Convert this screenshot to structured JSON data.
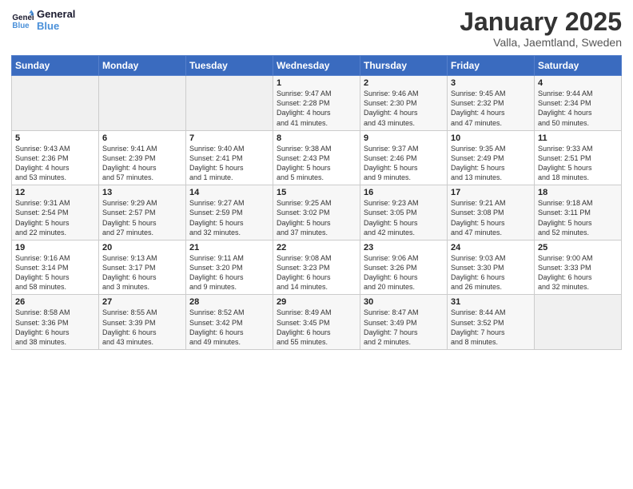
{
  "header": {
    "title": "January 2025",
    "subtitle": "Valla, Jaemtland, Sweden"
  },
  "days": [
    "Sunday",
    "Monday",
    "Tuesday",
    "Wednesday",
    "Thursday",
    "Friday",
    "Saturday"
  ],
  "weeks": [
    [
      {
        "day": "",
        "content": ""
      },
      {
        "day": "",
        "content": ""
      },
      {
        "day": "",
        "content": ""
      },
      {
        "day": "1",
        "content": "Sunrise: 9:47 AM\nSunset: 2:28 PM\nDaylight: 4 hours\nand 41 minutes."
      },
      {
        "day": "2",
        "content": "Sunrise: 9:46 AM\nSunset: 2:30 PM\nDaylight: 4 hours\nand 43 minutes."
      },
      {
        "day": "3",
        "content": "Sunrise: 9:45 AM\nSunset: 2:32 PM\nDaylight: 4 hours\nand 47 minutes."
      },
      {
        "day": "4",
        "content": "Sunrise: 9:44 AM\nSunset: 2:34 PM\nDaylight: 4 hours\nand 50 minutes."
      }
    ],
    [
      {
        "day": "5",
        "content": "Sunrise: 9:43 AM\nSunset: 2:36 PM\nDaylight: 4 hours\nand 53 minutes."
      },
      {
        "day": "6",
        "content": "Sunrise: 9:41 AM\nSunset: 2:39 PM\nDaylight: 4 hours\nand 57 minutes."
      },
      {
        "day": "7",
        "content": "Sunrise: 9:40 AM\nSunset: 2:41 PM\nDaylight: 5 hours\nand 1 minute."
      },
      {
        "day": "8",
        "content": "Sunrise: 9:38 AM\nSunset: 2:43 PM\nDaylight: 5 hours\nand 5 minutes."
      },
      {
        "day": "9",
        "content": "Sunrise: 9:37 AM\nSunset: 2:46 PM\nDaylight: 5 hours\nand 9 minutes."
      },
      {
        "day": "10",
        "content": "Sunrise: 9:35 AM\nSunset: 2:49 PM\nDaylight: 5 hours\nand 13 minutes."
      },
      {
        "day": "11",
        "content": "Sunrise: 9:33 AM\nSunset: 2:51 PM\nDaylight: 5 hours\nand 18 minutes."
      }
    ],
    [
      {
        "day": "12",
        "content": "Sunrise: 9:31 AM\nSunset: 2:54 PM\nDaylight: 5 hours\nand 22 minutes."
      },
      {
        "day": "13",
        "content": "Sunrise: 9:29 AM\nSunset: 2:57 PM\nDaylight: 5 hours\nand 27 minutes."
      },
      {
        "day": "14",
        "content": "Sunrise: 9:27 AM\nSunset: 2:59 PM\nDaylight: 5 hours\nand 32 minutes."
      },
      {
        "day": "15",
        "content": "Sunrise: 9:25 AM\nSunset: 3:02 PM\nDaylight: 5 hours\nand 37 minutes."
      },
      {
        "day": "16",
        "content": "Sunrise: 9:23 AM\nSunset: 3:05 PM\nDaylight: 5 hours\nand 42 minutes."
      },
      {
        "day": "17",
        "content": "Sunrise: 9:21 AM\nSunset: 3:08 PM\nDaylight: 5 hours\nand 47 minutes."
      },
      {
        "day": "18",
        "content": "Sunrise: 9:18 AM\nSunset: 3:11 PM\nDaylight: 5 hours\nand 52 minutes."
      }
    ],
    [
      {
        "day": "19",
        "content": "Sunrise: 9:16 AM\nSunset: 3:14 PM\nDaylight: 5 hours\nand 58 minutes."
      },
      {
        "day": "20",
        "content": "Sunrise: 9:13 AM\nSunset: 3:17 PM\nDaylight: 6 hours\nand 3 minutes."
      },
      {
        "day": "21",
        "content": "Sunrise: 9:11 AM\nSunset: 3:20 PM\nDaylight: 6 hours\nand 9 minutes."
      },
      {
        "day": "22",
        "content": "Sunrise: 9:08 AM\nSunset: 3:23 PM\nDaylight: 6 hours\nand 14 minutes."
      },
      {
        "day": "23",
        "content": "Sunrise: 9:06 AM\nSunset: 3:26 PM\nDaylight: 6 hours\nand 20 minutes."
      },
      {
        "day": "24",
        "content": "Sunrise: 9:03 AM\nSunset: 3:30 PM\nDaylight: 6 hours\nand 26 minutes."
      },
      {
        "day": "25",
        "content": "Sunrise: 9:00 AM\nSunset: 3:33 PM\nDaylight: 6 hours\nand 32 minutes."
      }
    ],
    [
      {
        "day": "26",
        "content": "Sunrise: 8:58 AM\nSunset: 3:36 PM\nDaylight: 6 hours\nand 38 minutes."
      },
      {
        "day": "27",
        "content": "Sunrise: 8:55 AM\nSunset: 3:39 PM\nDaylight: 6 hours\nand 43 minutes."
      },
      {
        "day": "28",
        "content": "Sunrise: 8:52 AM\nSunset: 3:42 PM\nDaylight: 6 hours\nand 49 minutes."
      },
      {
        "day": "29",
        "content": "Sunrise: 8:49 AM\nSunset: 3:45 PM\nDaylight: 6 hours\nand 55 minutes."
      },
      {
        "day": "30",
        "content": "Sunrise: 8:47 AM\nSunset: 3:49 PM\nDaylight: 7 hours\nand 2 minutes."
      },
      {
        "day": "31",
        "content": "Sunrise: 8:44 AM\nSunset: 3:52 PM\nDaylight: 7 hours\nand 8 minutes."
      },
      {
        "day": "",
        "content": ""
      }
    ]
  ]
}
